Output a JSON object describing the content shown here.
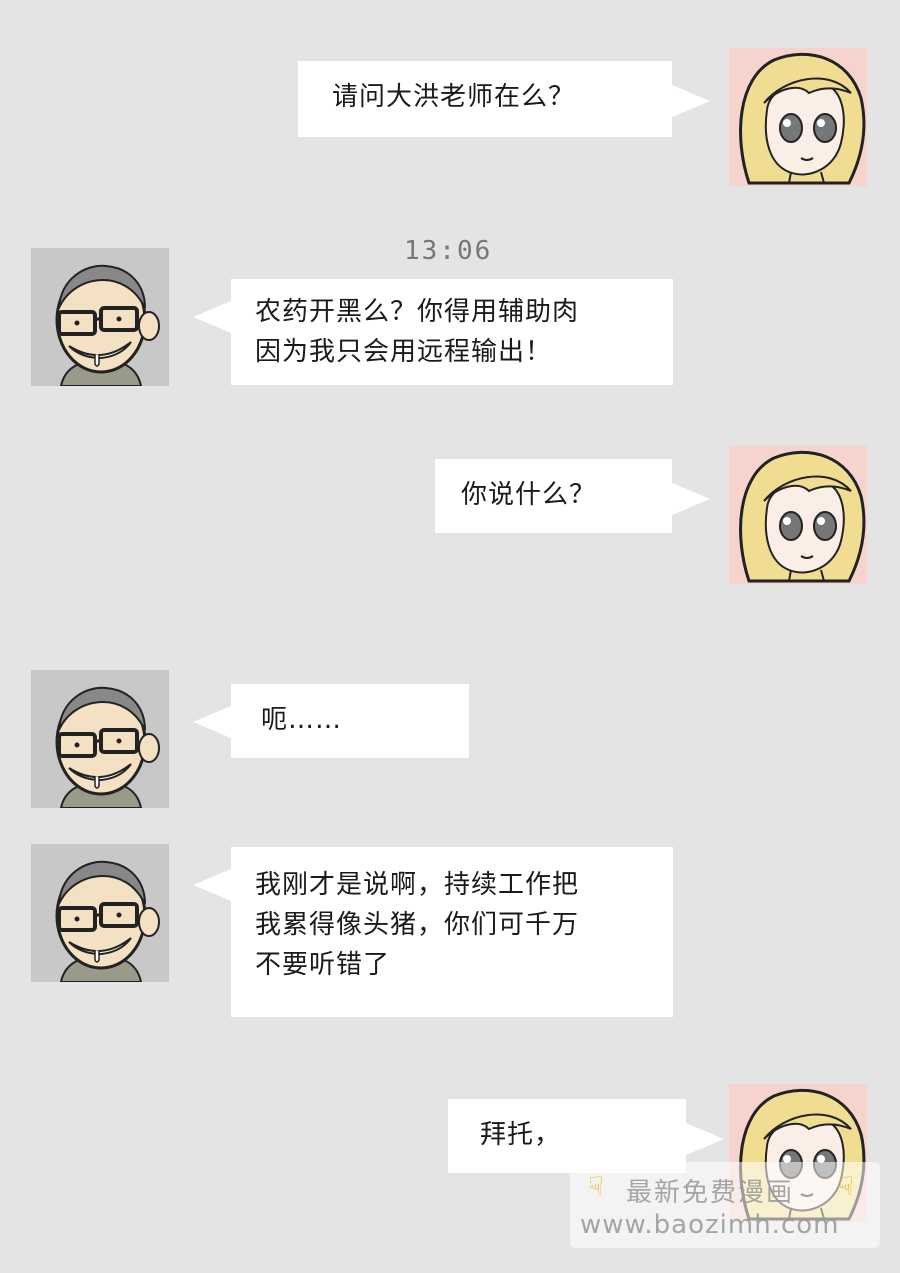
{
  "timestamp": "13:06",
  "messages": [
    {
      "sender": "girl",
      "lines": [
        "请问大洪老师在么？"
      ]
    },
    {
      "sender": "man",
      "lines": [
        "农药开黑么？你得用辅助肉",
        "因为我只会用远程输出！"
      ]
    },
    {
      "sender": "girl",
      "lines": [
        "你说什么？"
      ]
    },
    {
      "sender": "man",
      "lines": [
        "呃……"
      ]
    },
    {
      "sender": "man",
      "lines": [
        "我刚才是说啊，持续工作把",
        "我累得像头猪，你们可千万",
        "不要听错了"
      ]
    },
    {
      "sender": "girl",
      "lines": [
        "拜托，"
      ]
    }
  ],
  "avatars": {
    "girl": {
      "icon": "blonde-girl-avatar",
      "bg": "#f6d3cd"
    },
    "man": {
      "icon": "bald-man-glasses-avatar",
      "bg": "#c8c8c8"
    }
  },
  "watermark": {
    "line1": "最新免费漫画",
    "line2": "www.baozimh.com",
    "icon": "pointing-hand-icon"
  }
}
